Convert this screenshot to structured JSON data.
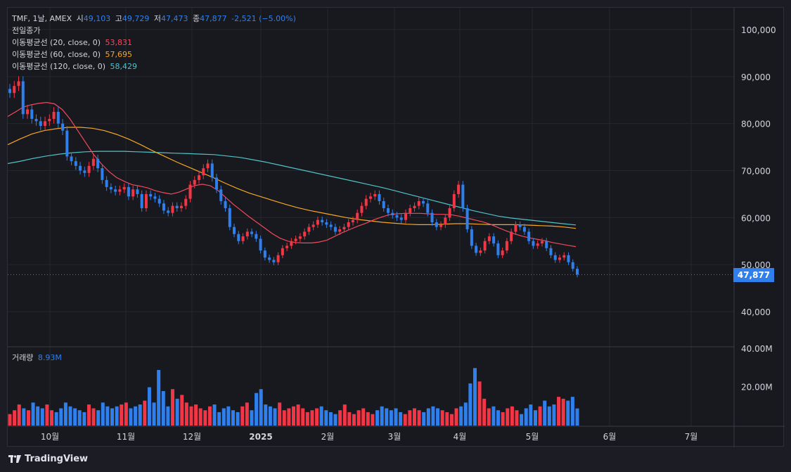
{
  "header": {
    "symbol": "TMF, 1날, AMEX",
    "open_label": "시",
    "open": "49,103",
    "high_label": "고",
    "high": "49,729",
    "low_label": "저",
    "low": "47,473",
    "close_label": "종",
    "close": "47,877",
    "change": "-2,521 (−5.00%)",
    "prev_close_label": "전일종가"
  },
  "indicators": [
    {
      "label": "이동평균선 (20, close, 0)",
      "value": "53,831",
      "color": "#f2495c"
    },
    {
      "label": "이동평균선 (60, close, 0)",
      "value": "57,695",
      "color": "#f5a623"
    },
    {
      "label": "이동평균선 (120, close, 0)",
      "value": "58,429",
      "color": "#4fc3c8"
    }
  ],
  "volume": {
    "label": "거래량",
    "value": "8.93M"
  },
  "price_tag": "47,877",
  "brand": "TradingView",
  "colors": {
    "up": "#f23645",
    "down": "#2f80ed",
    "ma20": "#f2495c",
    "ma60": "#f5a623",
    "ma120": "#4fc3c8"
  },
  "chart_data": {
    "type": "candlestick",
    "price_axis_ticks": [
      "100,000",
      "90,000",
      "80,000",
      "70,000",
      "60,000",
      "50,000",
      "40,000"
    ],
    "price_axis_values": [
      100000,
      90000,
      80000,
      70000,
      60000,
      50000,
      40000
    ],
    "volume_axis_ticks": [
      "40.00M",
      "20.00M"
    ],
    "volume_axis_values": [
      40,
      20
    ],
    "x_ticks": [
      "10월",
      "11월",
      "12월",
      "2025",
      "2월",
      "3월",
      "4월",
      "5월",
      "6월",
      "7월"
    ],
    "ylim": [
      35000,
      105000
    ],
    "volume_ylim": [
      0,
      40
    ],
    "last_close": 47877,
    "closes": [
      86500,
      88000,
      89000,
      82000,
      83000,
      81000,
      80500,
      79500,
      80500,
      81000,
      82500,
      80000,
      78500,
      73000,
      72000,
      71000,
      70000,
      69500,
      71000,
      72500,
      70500,
      68000,
      66500,
      66000,
      65500,
      66000,
      66500,
      64500,
      66000,
      65000,
      62000,
      65000,
      64500,
      64000,
      63000,
      61500,
      61000,
      62500,
      62000,
      62500,
      64000,
      67000,
      68000,
      69000,
      70500,
      71500,
      68500,
      66000,
      63500,
      62000,
      58000,
      56500,
      55000,
      56000,
      57000,
      56500,
      55500,
      53000,
      51500,
      51000,
      50500,
      52000,
      53500,
      54000,
      55000,
      55500,
      56000,
      57000,
      58000,
      58500,
      59500,
      59000,
      58500,
      58000,
      57000,
      57500,
      58000,
      59000,
      59500,
      61000,
      62500,
      64000,
      64500,
      65000,
      63500,
      62000,
      61000,
      60500,
      60000,
      59500,
      61000,
      62000,
      62500,
      63500,
      63000,
      61000,
      59000,
      58000,
      58500,
      60000,
      62000,
      65000,
      67000,
      62000,
      57500,
      54000,
      52500,
      53000,
      55000,
      56000,
      54500,
      52000,
      53000,
      55000,
      57000,
      58500,
      58000,
      57000,
      55000,
      54000,
      54500,
      55000,
      53500,
      52000,
      51000,
      51500,
      52000,
      50500,
      49103,
      47877
    ],
    "ma20": [
      81500,
      82500,
      83500,
      84000,
      84300,
      84500,
      84200,
      83000,
      81000,
      78500,
      76000,
      73500,
      71500,
      69800,
      68500,
      67700,
      67000,
      66700,
      66300,
      65700,
      65300,
      65000,
      65400,
      66100,
      66800,
      67100,
      66800,
      65800,
      64300,
      62800,
      61500,
      60200,
      59000,
      57800,
      56600,
      55600,
      55000,
      54700,
      54600,
      54600,
      54800,
      55200,
      56000,
      56800,
      57500,
      58200,
      58800,
      59500,
      60100,
      60600,
      60800,
      60900,
      60900,
      60900,
      60800,
      60700,
      60700,
      60600,
      60300,
      59900,
      59500,
      59100,
      58600,
      57900,
      57200,
      56600,
      56100,
      55700,
      55400,
      55100,
      54700,
      54400,
      54100,
      53831
    ],
    "ma60": [
      75500,
      76700,
      77800,
      78500,
      78900,
      79200,
      79200,
      79000,
      78500,
      77700,
      76700,
      75500,
      74200,
      73000,
      71800,
      70700,
      69600,
      68500,
      67300,
      66200,
      65200,
      64400,
      63600,
      62800,
      62100,
      61500,
      61000,
      60500,
      60000,
      59600,
      59300,
      59000,
      58800,
      58600,
      58500,
      58500,
      58600,
      58700,
      58700,
      58600,
      58500,
      58500,
      58500,
      58400,
      58300,
      58200,
      58000,
      57695
    ],
    "ma120": [
      71500,
      72000,
      72600,
      73100,
      73500,
      73800,
      74000,
      74100,
      74100,
      74100,
      74000,
      73900,
      73800,
      73700,
      73600,
      73500,
      73400,
      73100,
      72800,
      72300,
      71800,
      71200,
      70600,
      70000,
      69400,
      68800,
      68200,
      67600,
      67000,
      66400,
      65700,
      65000,
      64300,
      63600,
      62900,
      62200,
      61500,
      60900,
      60300,
      59900,
      59600,
      59300,
      59000,
      58700,
      58429
    ],
    "volumes_m": [
      6,
      8,
      11,
      9,
      8,
      12,
      10,
      9,
      11,
      8,
      7,
      9,
      12,
      10,
      9,
      8,
      7,
      11,
      9,
      8,
      12,
      10,
      9,
      10,
      11,
      12,
      9,
      10,
      11,
      13,
      20,
      12,
      29,
      18,
      10,
      19,
      14,
      16,
      12,
      10,
      11,
      9,
      8,
      10,
      11,
      7,
      9,
      10,
      8,
      7,
      10,
      12,
      8,
      17,
      19,
      11,
      10,
      9,
      12,
      8,
      9,
      10,
      11,
      9,
      7,
      8,
      9,
      10,
      8,
      7,
      6,
      8,
      11,
      7,
      6,
      8,
      9,
      7,
      6,
      8,
      10,
      9,
      8,
      9,
      7,
      6,
      8,
      9,
      8,
      7,
      9,
      10,
      9,
      8,
      7,
      6,
      9,
      10,
      12,
      22,
      30,
      23,
      14,
      9,
      10,
      8,
      7,
      9,
      10,
      8,
      6,
      9,
      11,
      8,
      10,
      13,
      10,
      11,
      15,
      14,
      13,
      15,
      8.93
    ]
  }
}
